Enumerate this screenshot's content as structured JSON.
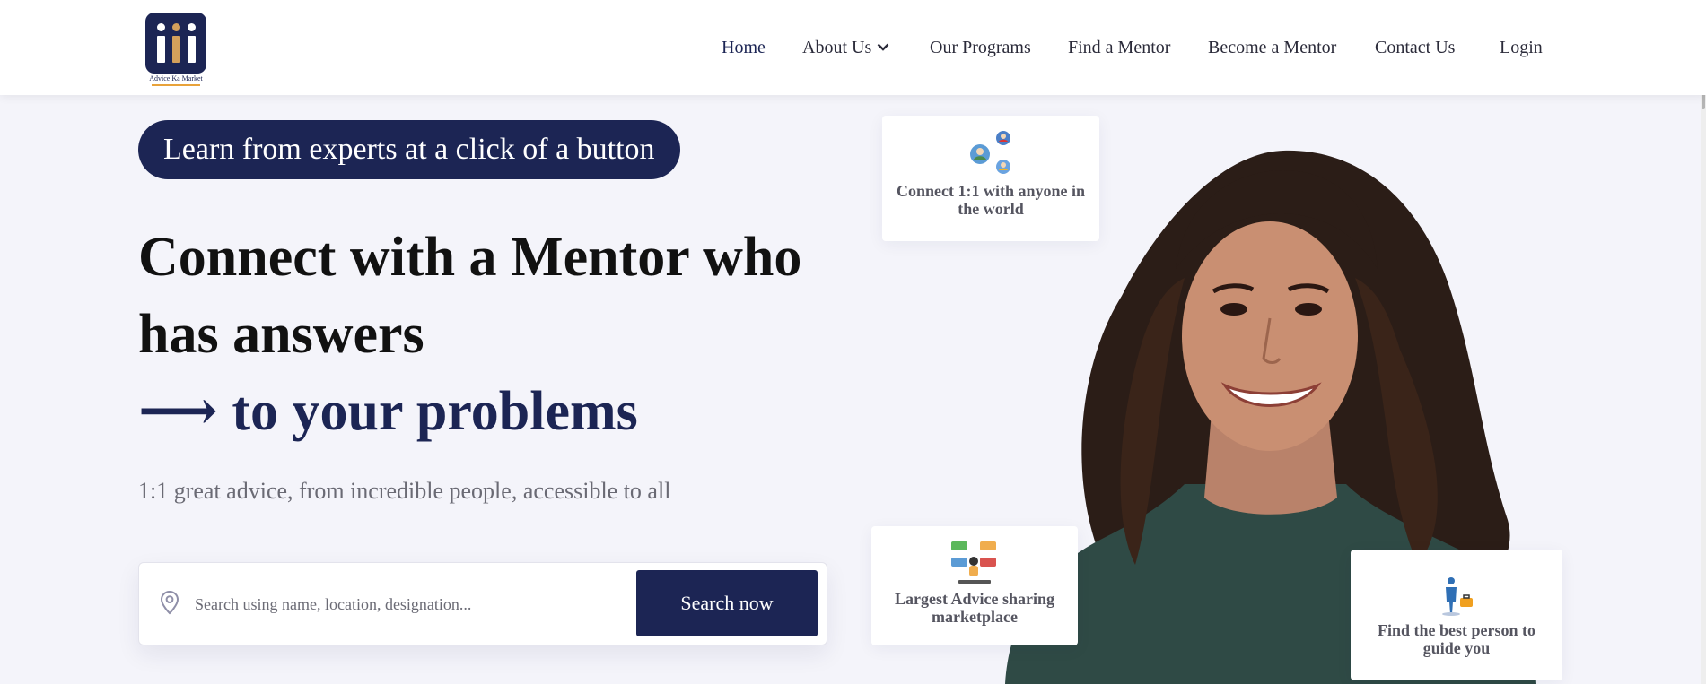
{
  "brand": {
    "logo_text": "Advice Ka Market",
    "navy": "#1c2554",
    "gold": "#d4a05b"
  },
  "nav": {
    "items": [
      {
        "label": "Home"
      },
      {
        "label": "About Us"
      },
      {
        "label": "Our Programs"
      },
      {
        "label": "Find a Mentor"
      },
      {
        "label": "Become a Mentor"
      },
      {
        "label": "Contact Us"
      },
      {
        "label": "Login"
      }
    ]
  },
  "hero": {
    "pill": "Learn from experts at a click of a button",
    "headline_1": "Connect with a Mentor who",
    "headline_2": "has answers",
    "headline_3": "⟶ to your problems",
    "subtext": "1:1 great advice, from incredible people, accessible to all"
  },
  "search": {
    "placeholder": "Search using name, location, designation...",
    "value": "",
    "button": "Search now",
    "icon": "location-pin-icon"
  },
  "cards": [
    {
      "text": "Connect 1:1 with anyone in the world",
      "icon": "people-network-icon"
    },
    {
      "text": "Largest Advice sharing marketplace",
      "icon": "chat-bubbles-icon"
    },
    {
      "text": "Find the best person to guide you",
      "icon": "person-briefcase-icon"
    }
  ]
}
